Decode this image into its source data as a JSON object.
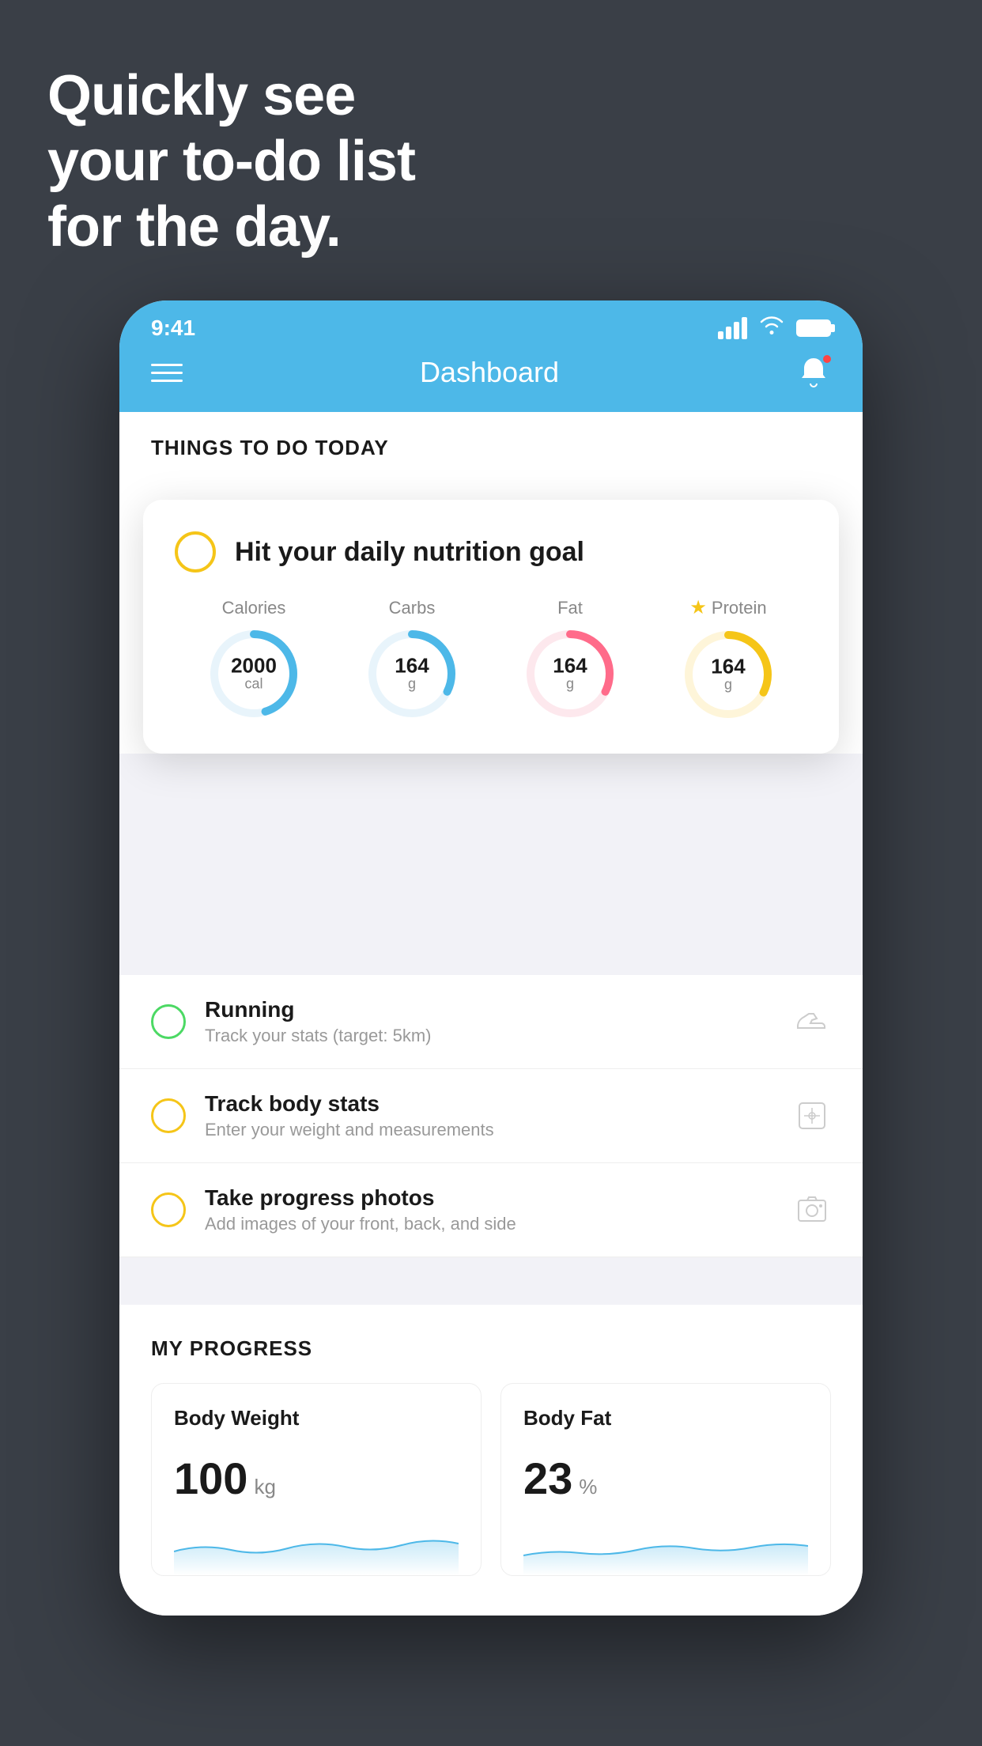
{
  "hero": {
    "line1": "Quickly see",
    "line2": "your to-do list",
    "line3": "for the day."
  },
  "status_bar": {
    "time": "9:41"
  },
  "nav": {
    "title": "Dashboard"
  },
  "things_header": {
    "title": "THINGS TO DO TODAY"
  },
  "nutrition_card": {
    "title": "Hit your daily nutrition goal",
    "stats": [
      {
        "label": "Calories",
        "value": "2000",
        "unit": "cal",
        "color": "#4db8e8",
        "star": false
      },
      {
        "label": "Carbs",
        "value": "164",
        "unit": "g",
        "color": "#4db8e8",
        "star": false
      },
      {
        "label": "Fat",
        "value": "164",
        "unit": "g",
        "color": "#ff6b8a",
        "star": false
      },
      {
        "label": "Protein",
        "value": "164",
        "unit": "g",
        "color": "#f5c518",
        "star": true
      }
    ]
  },
  "todo_items": [
    {
      "title": "Running",
      "subtitle": "Track your stats (target: 5km)",
      "circle_color": "green",
      "icon": "shoe"
    },
    {
      "title": "Track body stats",
      "subtitle": "Enter your weight and measurements",
      "circle_color": "yellow",
      "icon": "scale"
    },
    {
      "title": "Take progress photos",
      "subtitle": "Add images of your front, back, and side",
      "circle_color": "yellow",
      "icon": "photo"
    }
  ],
  "progress": {
    "section_title": "MY PROGRESS",
    "cards": [
      {
        "title": "Body Weight",
        "value": "100",
        "unit": "kg"
      },
      {
        "title": "Body Fat",
        "value": "23",
        "unit": "%"
      }
    ]
  }
}
